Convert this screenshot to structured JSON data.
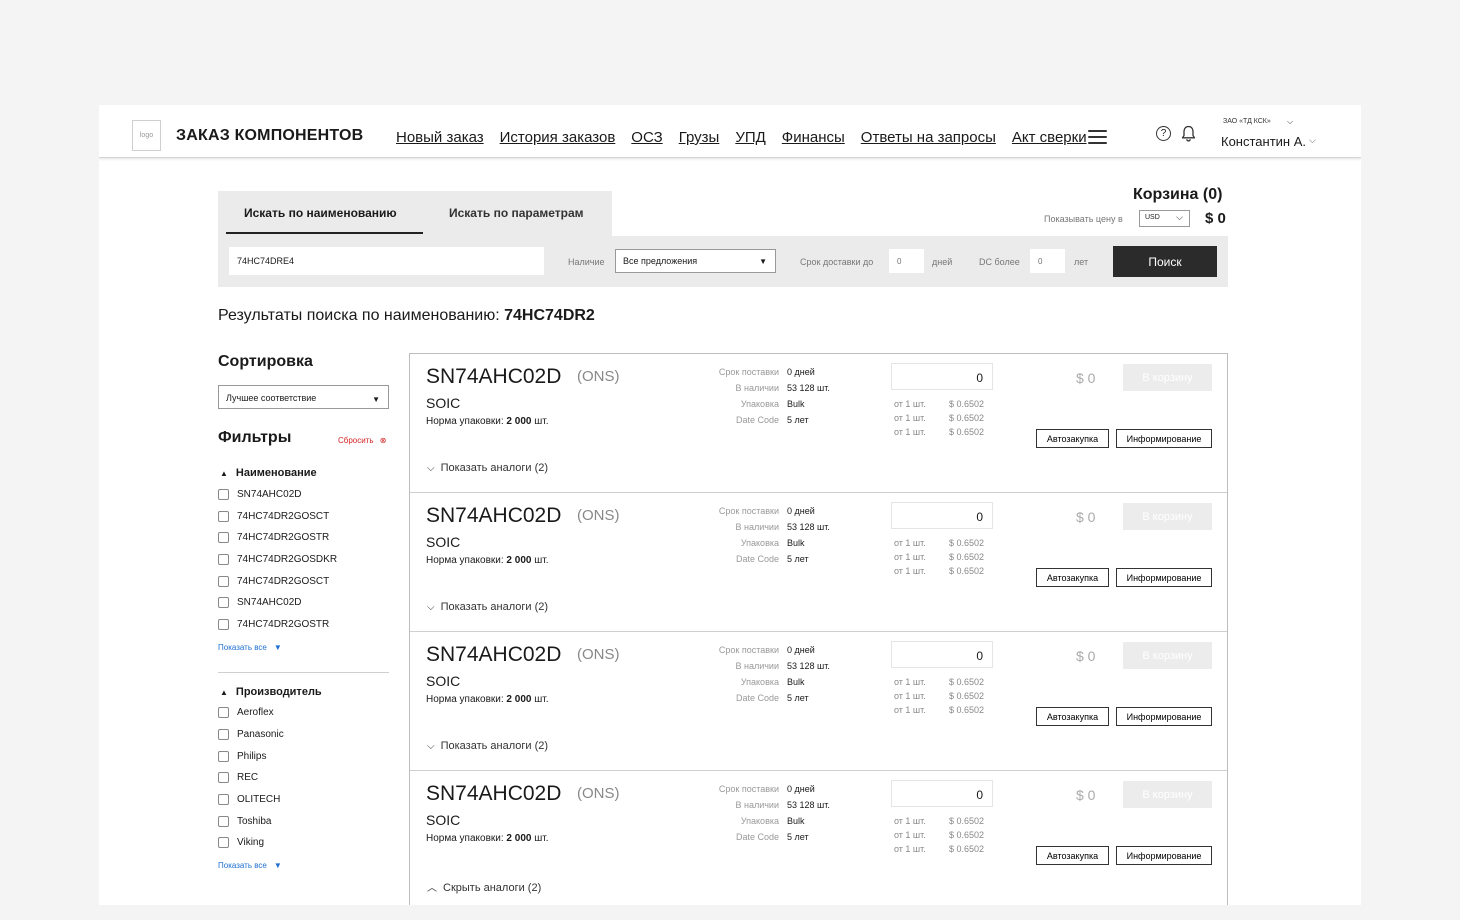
{
  "header": {
    "logo": "logo",
    "app_title": "ЗАКАЗ КОМПОНЕНТОВ",
    "nav": [
      "Новый заказ",
      "История заказов",
      "ОСЗ",
      "Грузы",
      "УПД",
      "Финансы",
      "Ответы на запросы",
      "Акт сверки"
    ],
    "company": "ЗАО «ТД КСК»",
    "user": "Константин А."
  },
  "search": {
    "tabs": [
      "Искать по наименованию",
      "Искать по параметрам"
    ],
    "query": "74HC74DRE4",
    "availability_label": "Наличие",
    "availability_value": "Все предложения",
    "delivery_label": "Срок доставки до",
    "delivery_value": "0",
    "delivery_unit": "дней",
    "dc_label": "DC более",
    "dc_value": "0",
    "dc_unit": "лет",
    "button": "Поиск"
  },
  "cart": {
    "title": "Корзина (0)",
    "price_label": "Показывать цену в",
    "currency": "USD",
    "total": "$ 0"
  },
  "results": {
    "title_prefix": "Результаты поиска по наименованию:",
    "query": "74HC74DR2"
  },
  "sidebar": {
    "sort_title": "Сортировка",
    "sort_value": "Лучшее соответствие",
    "filters_title": "Фильтры",
    "reset": "Сбросить",
    "groups": [
      {
        "title": "Наименование",
        "items": [
          "SN74AHC02D",
          "74HC74DR2GOSCT",
          "74HC74DR2GOSTR",
          "74HC74DR2GOSDKR",
          "74HC74DR2GOSCT",
          "SN74AHC02D",
          "74HC74DR2GOSTR"
        ],
        "show_all": "Показать все"
      },
      {
        "title": "Производитель",
        "items": [
          "Aeroflex",
          "Panasonic",
          "Philips",
          "REC",
          "OLITECH",
          "Toshiba",
          "Viking"
        ],
        "show_all": "Показать все"
      }
    ]
  },
  "products": [
    {
      "pn": "SN74AHC02D",
      "brand": "(ONS)",
      "package": "SOIC",
      "norm_label": "Норма упаковки:",
      "norm_value": "2 000",
      "norm_unit": "шт.",
      "attrs": [
        {
          "k": "Срок поставки",
          "v": "0 дней"
        },
        {
          "k": "В наличии",
          "v": "53 128 шт."
        },
        {
          "k": "Упаковка",
          "v": "Bulk"
        },
        {
          "k": "Date Code",
          "v": "5 лет"
        }
      ],
      "qty": "0",
      "tiers": [
        {
          "q": "от 1 шт.",
          "p": "$ 0.6502"
        },
        {
          "q": "от 1 шт.",
          "p": "$ 0.6502"
        },
        {
          "q": "от 1 шт.",
          "p": "$ 0.6502"
        }
      ],
      "sum": "$ 0",
      "cart_btn": "В корзину",
      "auto_btn": "Автозакупка",
      "inform_btn": "Информирование",
      "toggle": "Показать аналоги (2)",
      "toggle_icon": "chevron-down-icon"
    },
    {
      "pn": "SN74AHC02D",
      "brand": "(ONS)",
      "package": "SOIC",
      "norm_label": "Норма упаковки:",
      "norm_value": "2 000",
      "norm_unit": "шт.",
      "attrs": [
        {
          "k": "Срок поставки",
          "v": "0 дней"
        },
        {
          "k": "В наличии",
          "v": "53 128 шт."
        },
        {
          "k": "Упаковка",
          "v": "Bulk"
        },
        {
          "k": "Date Code",
          "v": "5 лет"
        }
      ],
      "qty": "0",
      "tiers": [
        {
          "q": "от 1 шт.",
          "p": "$ 0.6502"
        },
        {
          "q": "от 1 шт.",
          "p": "$ 0.6502"
        },
        {
          "q": "от 1 шт.",
          "p": "$ 0.6502"
        }
      ],
      "sum": "$ 0",
      "cart_btn": "В корзину",
      "auto_btn": "Автозакупка",
      "inform_btn": "Информирование",
      "toggle": "Показать аналоги (2)",
      "toggle_icon": "chevron-down-icon"
    },
    {
      "pn": "SN74AHC02D",
      "brand": "(ONS)",
      "package": "SOIC",
      "norm_label": "Норма упаковки:",
      "norm_value": "2 000",
      "norm_unit": "шт.",
      "attrs": [
        {
          "k": "Срок поставки",
          "v": "0 дней"
        },
        {
          "k": "В наличии",
          "v": "53 128 шт."
        },
        {
          "k": "Упаковка",
          "v": "Bulk"
        },
        {
          "k": "Date Code",
          "v": "5 лет"
        }
      ],
      "qty": "0",
      "tiers": [
        {
          "q": "от 1 шт.",
          "p": "$ 0.6502"
        },
        {
          "q": "от 1 шт.",
          "p": "$ 0.6502"
        },
        {
          "q": "от 1 шт.",
          "p": "$ 0.6502"
        }
      ],
      "sum": "$ 0",
      "cart_btn": "В корзину",
      "auto_btn": "Автозакупка",
      "inform_btn": "Информирование",
      "toggle": "Показать аналоги (2)",
      "toggle_icon": "chevron-down-icon"
    },
    {
      "pn": "SN74AHC02D",
      "brand": "(ONS)",
      "package": "SOIC",
      "norm_label": "Норма упаковки:",
      "norm_value": "2 000",
      "norm_unit": "шт.",
      "attrs": [
        {
          "k": "Срок поставки",
          "v": "0 дней"
        },
        {
          "k": "В наличии",
          "v": "53 128 шт."
        },
        {
          "k": "Упаковка",
          "v": "Bulk"
        },
        {
          "k": "Date Code",
          "v": "5 лет"
        }
      ],
      "qty": "0",
      "tiers": [
        {
          "q": "от 1 шт.",
          "p": "$ 0.6502"
        },
        {
          "q": "от 1 шт.",
          "p": "$ 0.6502"
        },
        {
          "q": "от 1 шт.",
          "p": "$ 0.6502"
        }
      ],
      "sum": "$ 0",
      "cart_btn": "В корзину",
      "auto_btn": "Автозакупка",
      "inform_btn": "Информирование",
      "toggle": "Скрыть аналоги (2)",
      "toggle_icon": "chevron-up-icon"
    }
  ]
}
